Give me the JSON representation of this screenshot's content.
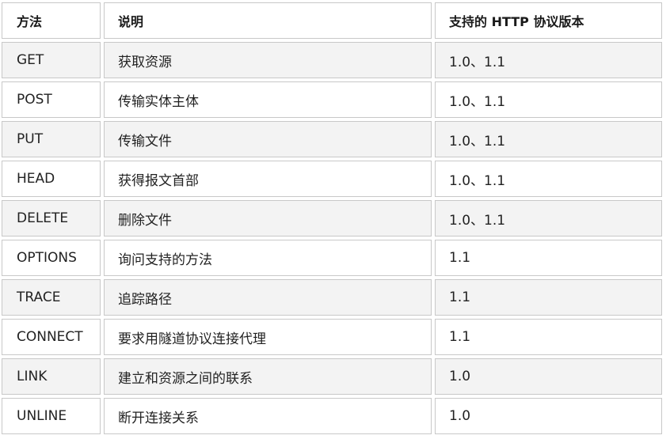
{
  "table": {
    "headers": [
      "方法",
      "说明",
      "支持的 HTTP 协议版本"
    ],
    "rows": [
      [
        "GET",
        "获取资源",
        "1.0、1.1"
      ],
      [
        "POST",
        "传输实体主体",
        "1.0、1.1"
      ],
      [
        "PUT",
        "传输文件",
        "1.0、1.1"
      ],
      [
        "HEAD",
        "获得报文首部",
        "1.0、1.1"
      ],
      [
        "DELETE",
        "删除文件",
        "1.0、1.1"
      ],
      [
        "OPTIONS",
        "询问支持的方法",
        "1.1"
      ],
      [
        "TRACE",
        "追踪路径",
        "1.1"
      ],
      [
        "CONNECT",
        "要求用隧道协议连接代理",
        "1.1"
      ],
      [
        "LINK",
        "建立和资源之间的联系",
        "1.0"
      ],
      [
        "UNLINE",
        "断开连接关系",
        "1.0"
      ]
    ]
  }
}
